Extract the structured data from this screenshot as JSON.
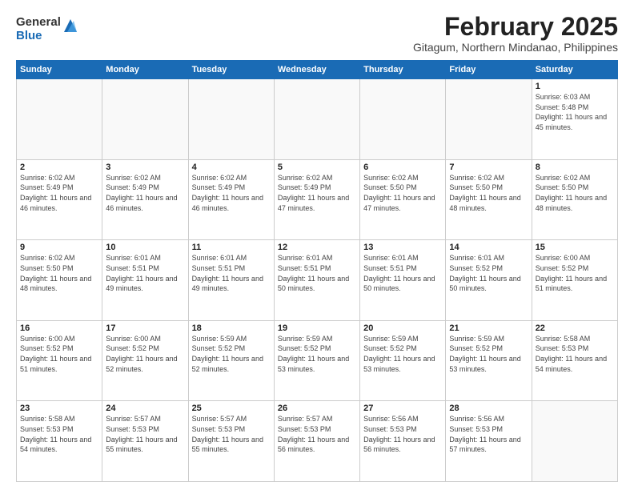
{
  "logo": {
    "general": "General",
    "blue": "Blue"
  },
  "title": "February 2025",
  "subtitle": "Gitagum, Northern Mindanao, Philippines",
  "days_header": [
    "Sunday",
    "Monday",
    "Tuesday",
    "Wednesday",
    "Thursday",
    "Friday",
    "Saturday"
  ],
  "weeks": [
    [
      {
        "num": "",
        "info": ""
      },
      {
        "num": "",
        "info": ""
      },
      {
        "num": "",
        "info": ""
      },
      {
        "num": "",
        "info": ""
      },
      {
        "num": "",
        "info": ""
      },
      {
        "num": "",
        "info": ""
      },
      {
        "num": "1",
        "info": "Sunrise: 6:03 AM\nSunset: 5:48 PM\nDaylight: 11 hours and 45 minutes."
      }
    ],
    [
      {
        "num": "2",
        "info": "Sunrise: 6:02 AM\nSunset: 5:49 PM\nDaylight: 11 hours and 46 minutes."
      },
      {
        "num": "3",
        "info": "Sunrise: 6:02 AM\nSunset: 5:49 PM\nDaylight: 11 hours and 46 minutes."
      },
      {
        "num": "4",
        "info": "Sunrise: 6:02 AM\nSunset: 5:49 PM\nDaylight: 11 hours and 46 minutes."
      },
      {
        "num": "5",
        "info": "Sunrise: 6:02 AM\nSunset: 5:49 PM\nDaylight: 11 hours and 47 minutes."
      },
      {
        "num": "6",
        "info": "Sunrise: 6:02 AM\nSunset: 5:50 PM\nDaylight: 11 hours and 47 minutes."
      },
      {
        "num": "7",
        "info": "Sunrise: 6:02 AM\nSunset: 5:50 PM\nDaylight: 11 hours and 48 minutes."
      },
      {
        "num": "8",
        "info": "Sunrise: 6:02 AM\nSunset: 5:50 PM\nDaylight: 11 hours and 48 minutes."
      }
    ],
    [
      {
        "num": "9",
        "info": "Sunrise: 6:02 AM\nSunset: 5:50 PM\nDaylight: 11 hours and 48 minutes."
      },
      {
        "num": "10",
        "info": "Sunrise: 6:01 AM\nSunset: 5:51 PM\nDaylight: 11 hours and 49 minutes."
      },
      {
        "num": "11",
        "info": "Sunrise: 6:01 AM\nSunset: 5:51 PM\nDaylight: 11 hours and 49 minutes."
      },
      {
        "num": "12",
        "info": "Sunrise: 6:01 AM\nSunset: 5:51 PM\nDaylight: 11 hours and 50 minutes."
      },
      {
        "num": "13",
        "info": "Sunrise: 6:01 AM\nSunset: 5:51 PM\nDaylight: 11 hours and 50 minutes."
      },
      {
        "num": "14",
        "info": "Sunrise: 6:01 AM\nSunset: 5:52 PM\nDaylight: 11 hours and 50 minutes."
      },
      {
        "num": "15",
        "info": "Sunrise: 6:00 AM\nSunset: 5:52 PM\nDaylight: 11 hours and 51 minutes."
      }
    ],
    [
      {
        "num": "16",
        "info": "Sunrise: 6:00 AM\nSunset: 5:52 PM\nDaylight: 11 hours and 51 minutes."
      },
      {
        "num": "17",
        "info": "Sunrise: 6:00 AM\nSunset: 5:52 PM\nDaylight: 11 hours and 52 minutes."
      },
      {
        "num": "18",
        "info": "Sunrise: 5:59 AM\nSunset: 5:52 PM\nDaylight: 11 hours and 52 minutes."
      },
      {
        "num": "19",
        "info": "Sunrise: 5:59 AM\nSunset: 5:52 PM\nDaylight: 11 hours and 53 minutes."
      },
      {
        "num": "20",
        "info": "Sunrise: 5:59 AM\nSunset: 5:52 PM\nDaylight: 11 hours and 53 minutes."
      },
      {
        "num": "21",
        "info": "Sunrise: 5:59 AM\nSunset: 5:52 PM\nDaylight: 11 hours and 53 minutes."
      },
      {
        "num": "22",
        "info": "Sunrise: 5:58 AM\nSunset: 5:53 PM\nDaylight: 11 hours and 54 minutes."
      }
    ],
    [
      {
        "num": "23",
        "info": "Sunrise: 5:58 AM\nSunset: 5:53 PM\nDaylight: 11 hours and 54 minutes."
      },
      {
        "num": "24",
        "info": "Sunrise: 5:57 AM\nSunset: 5:53 PM\nDaylight: 11 hours and 55 minutes."
      },
      {
        "num": "25",
        "info": "Sunrise: 5:57 AM\nSunset: 5:53 PM\nDaylight: 11 hours and 55 minutes."
      },
      {
        "num": "26",
        "info": "Sunrise: 5:57 AM\nSunset: 5:53 PM\nDaylight: 11 hours and 56 minutes."
      },
      {
        "num": "27",
        "info": "Sunrise: 5:56 AM\nSunset: 5:53 PM\nDaylight: 11 hours and 56 minutes."
      },
      {
        "num": "28",
        "info": "Sunrise: 5:56 AM\nSunset: 5:53 PM\nDaylight: 11 hours and 57 minutes."
      },
      {
        "num": "",
        "info": ""
      }
    ]
  ]
}
